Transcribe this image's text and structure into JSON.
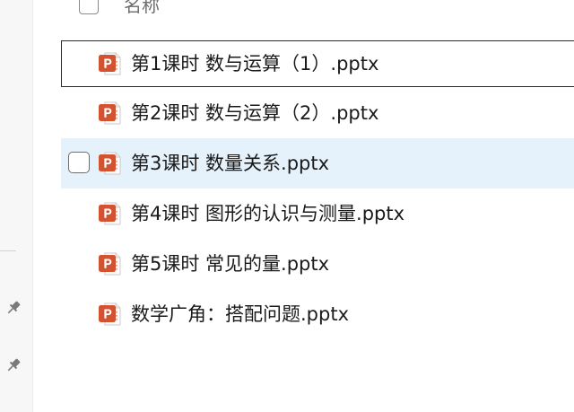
{
  "header": {
    "name_column": "名称"
  },
  "files": [
    {
      "name": "第1课时 数与运算（1）.pptx",
      "icon": "powerpoint-icon",
      "state": "focused"
    },
    {
      "name": "第2课时 数与运算（2）.pptx",
      "icon": "powerpoint-icon",
      "state": "normal"
    },
    {
      "name": "第3课时 数量关系.pptx",
      "icon": "powerpoint-icon",
      "state": "hovered"
    },
    {
      "name": "第4课时 图形的认识与测量.pptx",
      "icon": "powerpoint-icon",
      "state": "normal"
    },
    {
      "name": "第5课时 常见的量.pptx",
      "icon": "powerpoint-icon",
      "state": "normal"
    },
    {
      "name": "数学广角：搭配问题.pptx",
      "icon": "powerpoint-icon",
      "state": "normal"
    }
  ],
  "nav": {
    "pins": [
      "pin-icon",
      "pin-icon"
    ]
  },
  "colors": {
    "hover_background": "#e5f1fb",
    "powerpoint_orange": "#d35230",
    "text": "#1a1a1a"
  }
}
